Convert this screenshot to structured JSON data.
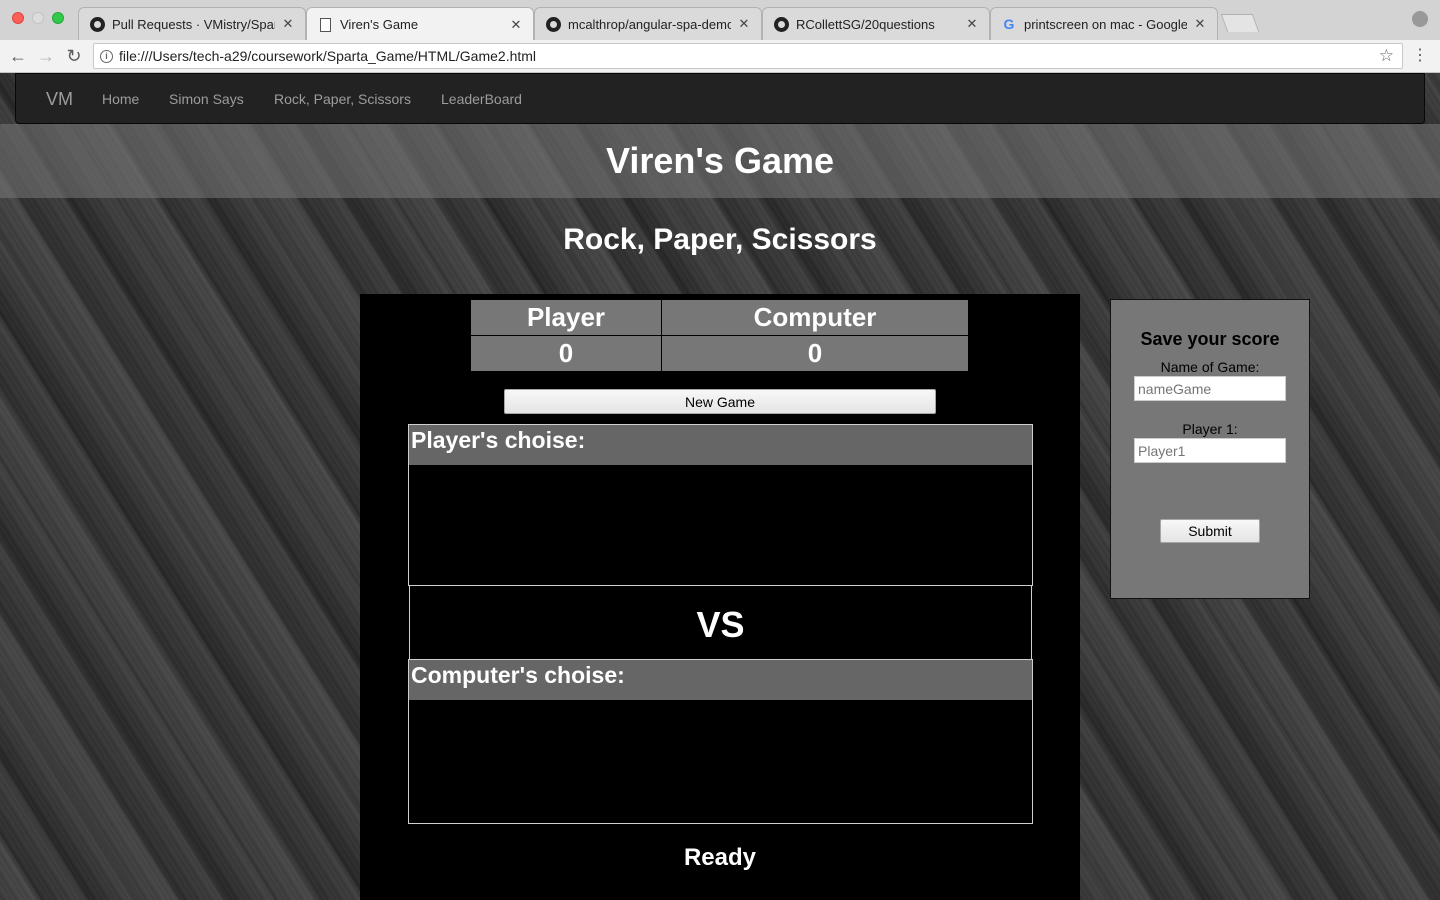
{
  "browser": {
    "tabs": [
      {
        "title": "Pull Requests · VMistry/Sparta_Game",
        "icon": "github-icon"
      },
      {
        "title": "Viren's Game",
        "icon": "document-icon"
      },
      {
        "title": "mcalthrop/angular-spa-demo",
        "icon": "github-icon"
      },
      {
        "title": "RCollettSG/20questions",
        "icon": "github-icon"
      },
      {
        "title": "printscreen on mac - Google Search",
        "icon": "google-icon"
      }
    ],
    "tab_close": "✕",
    "url": "file:///Users/tech-a29/coursework/Sparta_Game/HTML/Game2.html"
  },
  "navbar": {
    "brand": "VM",
    "links": [
      "Home",
      "Simon Says",
      "Rock, Paper, Scissors",
      "LeaderBoard"
    ]
  },
  "header": {
    "title": "Viren's Game"
  },
  "game": {
    "title": "Rock, Paper, Scissors",
    "score": {
      "headers": [
        "Player",
        "Computer"
      ],
      "values": [
        "0",
        "0"
      ]
    },
    "new_game_label": "New Game",
    "player_choice_label": "Player's choise:",
    "vs_label": "VS",
    "computer_choice_label": "Computer's choise:",
    "status": "Ready"
  },
  "save_form": {
    "title": "Save your score",
    "game_name_label": "Name of Game:",
    "game_name_placeholder": "nameGame",
    "player_label": "Player 1:",
    "player_placeholder": "Player1",
    "submit_label": "Submit"
  }
}
